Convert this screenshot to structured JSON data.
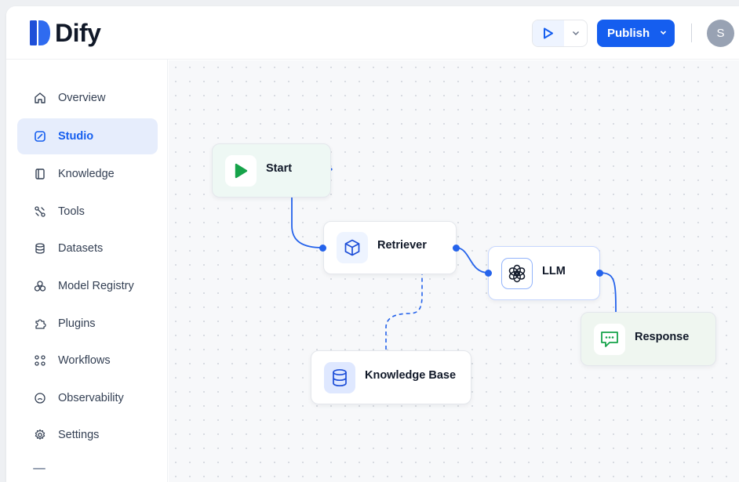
{
  "app": {
    "name": "Dify"
  },
  "header": {
    "run_icon": "play-icon",
    "publish_label": "Publish",
    "avatar_initial": "S"
  },
  "sidebar": {
    "items": [
      {
        "label": "Overview",
        "icon": "home-icon",
        "active": false
      },
      {
        "label": "Studio",
        "icon": "edit-square-icon",
        "active": true
      },
      {
        "label": "Knowledge",
        "icon": "book-icon",
        "active": false
      },
      {
        "label": "Tools",
        "icon": "tools-icon",
        "active": false
      },
      {
        "label": "Datasets",
        "icon": "database-icon",
        "active": false
      },
      {
        "label": "Model Registry",
        "icon": "cubes-icon",
        "active": false
      },
      {
        "label": "Plugins",
        "icon": "puzzle-icon",
        "active": false
      },
      {
        "label": "Workflows",
        "icon": "workflow-icon",
        "active": false
      },
      {
        "label": "Observability",
        "icon": "gauge-icon",
        "active": false
      },
      {
        "label": "Settings",
        "icon": "gear-icon",
        "active": false
      }
    ]
  },
  "workflow": {
    "nodes": [
      {
        "id": "start",
        "label": "Start",
        "icon": "play-icon"
      },
      {
        "id": "retriever",
        "label": "Retriever",
        "icon": "cube-icon"
      },
      {
        "id": "llm",
        "label": "LLM",
        "icon": "openai-icon"
      },
      {
        "id": "response",
        "label": "Response",
        "icon": "chat-bubble-icon"
      },
      {
        "id": "knowledge_base",
        "label": "Knowledge Base",
        "icon": "database-icon"
      }
    ]
  },
  "colors": {
    "accent": "#155eef",
    "edge": "#2563eb",
    "start_node_bg": "#eef8f4",
    "response_node_bg": "#eff6f0",
    "start_icon": "#16a34a"
  }
}
